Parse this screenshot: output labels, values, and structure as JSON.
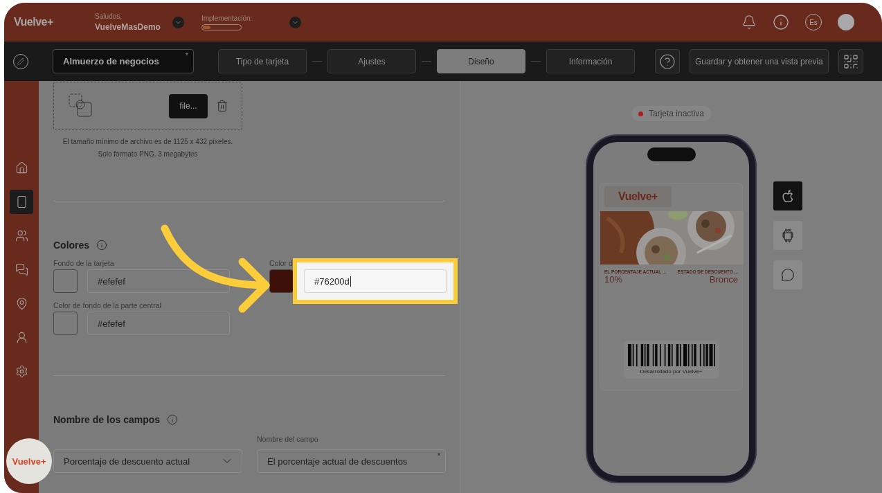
{
  "header": {
    "logo": "Vuelve+",
    "greeting": "Saludos,",
    "user": "VuelveMasDemo",
    "implementation": {
      "label": "Implementación:",
      "level": 0.2
    },
    "language": "Es"
  },
  "toolbar": {
    "card_name": {
      "value": "Almuerzo de negocios",
      "marker": "*"
    },
    "steps": [
      {
        "label": "Tipo de tarjeta",
        "selected": false
      },
      {
        "label": "Ajustes",
        "selected": false
      },
      {
        "label": "Diseño",
        "selected": true
      },
      {
        "label": "Información",
        "selected": false
      }
    ],
    "save_button": "Guardar y obtener una vista previa"
  },
  "sidebar": {
    "items": [
      {
        "kind": "home",
        "selected": false
      },
      {
        "kind": "card",
        "selected": true
      },
      {
        "kind": "users",
        "selected": false
      },
      {
        "kind": "chat",
        "selected": false
      },
      {
        "kind": "location",
        "selected": false
      },
      {
        "kind": "user",
        "selected": false
      },
      {
        "kind": "settings",
        "selected": false
      }
    ]
  },
  "upload": {
    "button": "file...",
    "caption": "El tamaño mínimo de archivo es de 1125 x 432 píxeles.",
    "caption_2": "Solo formato PNG. 3 megabytes"
  },
  "colors": {
    "title": "Colores",
    "fields": [
      {
        "label": "Fondo de la tarjeta",
        "value": "#efefef",
        "highlighted": false
      },
      {
        "label": "Color d",
        "value": "#76200d",
        "highlighted": true
      },
      {
        "label": "Color de fondo de la parte central",
        "value": "#efefef",
        "highlighted": false
      }
    ]
  },
  "field_names": {
    "title": "Nombre de los campos",
    "field": "Porcentaje de descuento actual",
    "name_label": "Nombre del campo",
    "name_value": "El porcentaje actual de descuentos",
    "marker": "*"
  },
  "preview": {
    "status": {
      "label": "Tarjeta inactiva",
      "active": false
    },
    "card": {
      "logo": "Vuelve+",
      "fields": [
        {
          "label": "EL PORCENTAJE ACTUAL ...",
          "value": "10%"
        },
        {
          "label": "ESTADO DE DESCUENTO ...",
          "value": "Bronce"
        }
      ],
      "footer": "Desarrollado por Vuelve+"
    },
    "platforms": [
      {
        "kind": "apple",
        "selected": true
      },
      {
        "kind": "android",
        "selected": false
      },
      {
        "kind": "chat",
        "selected": false
      }
    ]
  },
  "bubble": {
    "logo": "Vuelve+"
  }
}
